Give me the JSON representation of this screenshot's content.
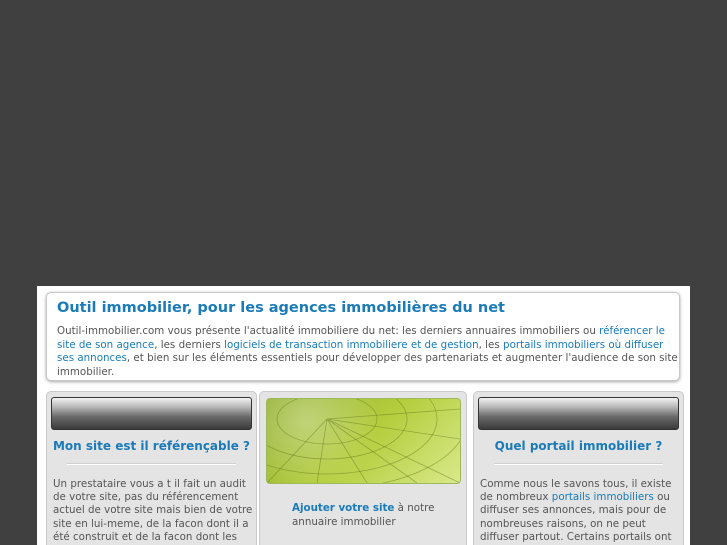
{
  "intro": {
    "title": "Outil immobilier, pour les agences immobilières du net",
    "p1": "Outil-immobilier.com vous présente l'actualité immobiliere du net: les derniers annuaires immobiliers ou ",
    "link1": "référencer le site de son agence",
    "p2": ", les derniers ",
    "link2": "logiciels de transaction immobiliere et de gestion",
    "p3": ", les ",
    "link3": "portails immobiliers où diffuser ses annonces",
    "p4": ", et bien sur les éléments essentiels pour développer des partenariats et augmenter l'audience de son site immobilier."
  },
  "left": {
    "title": "Mon site est il référençable ?",
    "text": "Un prestataire vous a t il fait un audit de votre site, pas du référencement actuel de votre site mais bien de votre site en lui-meme, de la facon dont il a été construit et de la facon dont les moteurs de recherche"
  },
  "middle": {
    "link": "Ajouter votre site",
    "text": " à notre annuaire immobilier"
  },
  "right": {
    "title": "Quel portail immobilier ?",
    "t1": "Comme nous le savons tous, il existe de nombreux ",
    "link": "portails immobiliers",
    "t2": " ou diffuser ses annonces, mais pour de nombreuses raisons, on ne peut diffuser partout. Certains portails ont un excellent retour sur"
  },
  "colors": {
    "link": "#1a7bb8",
    "background": "#404040"
  }
}
